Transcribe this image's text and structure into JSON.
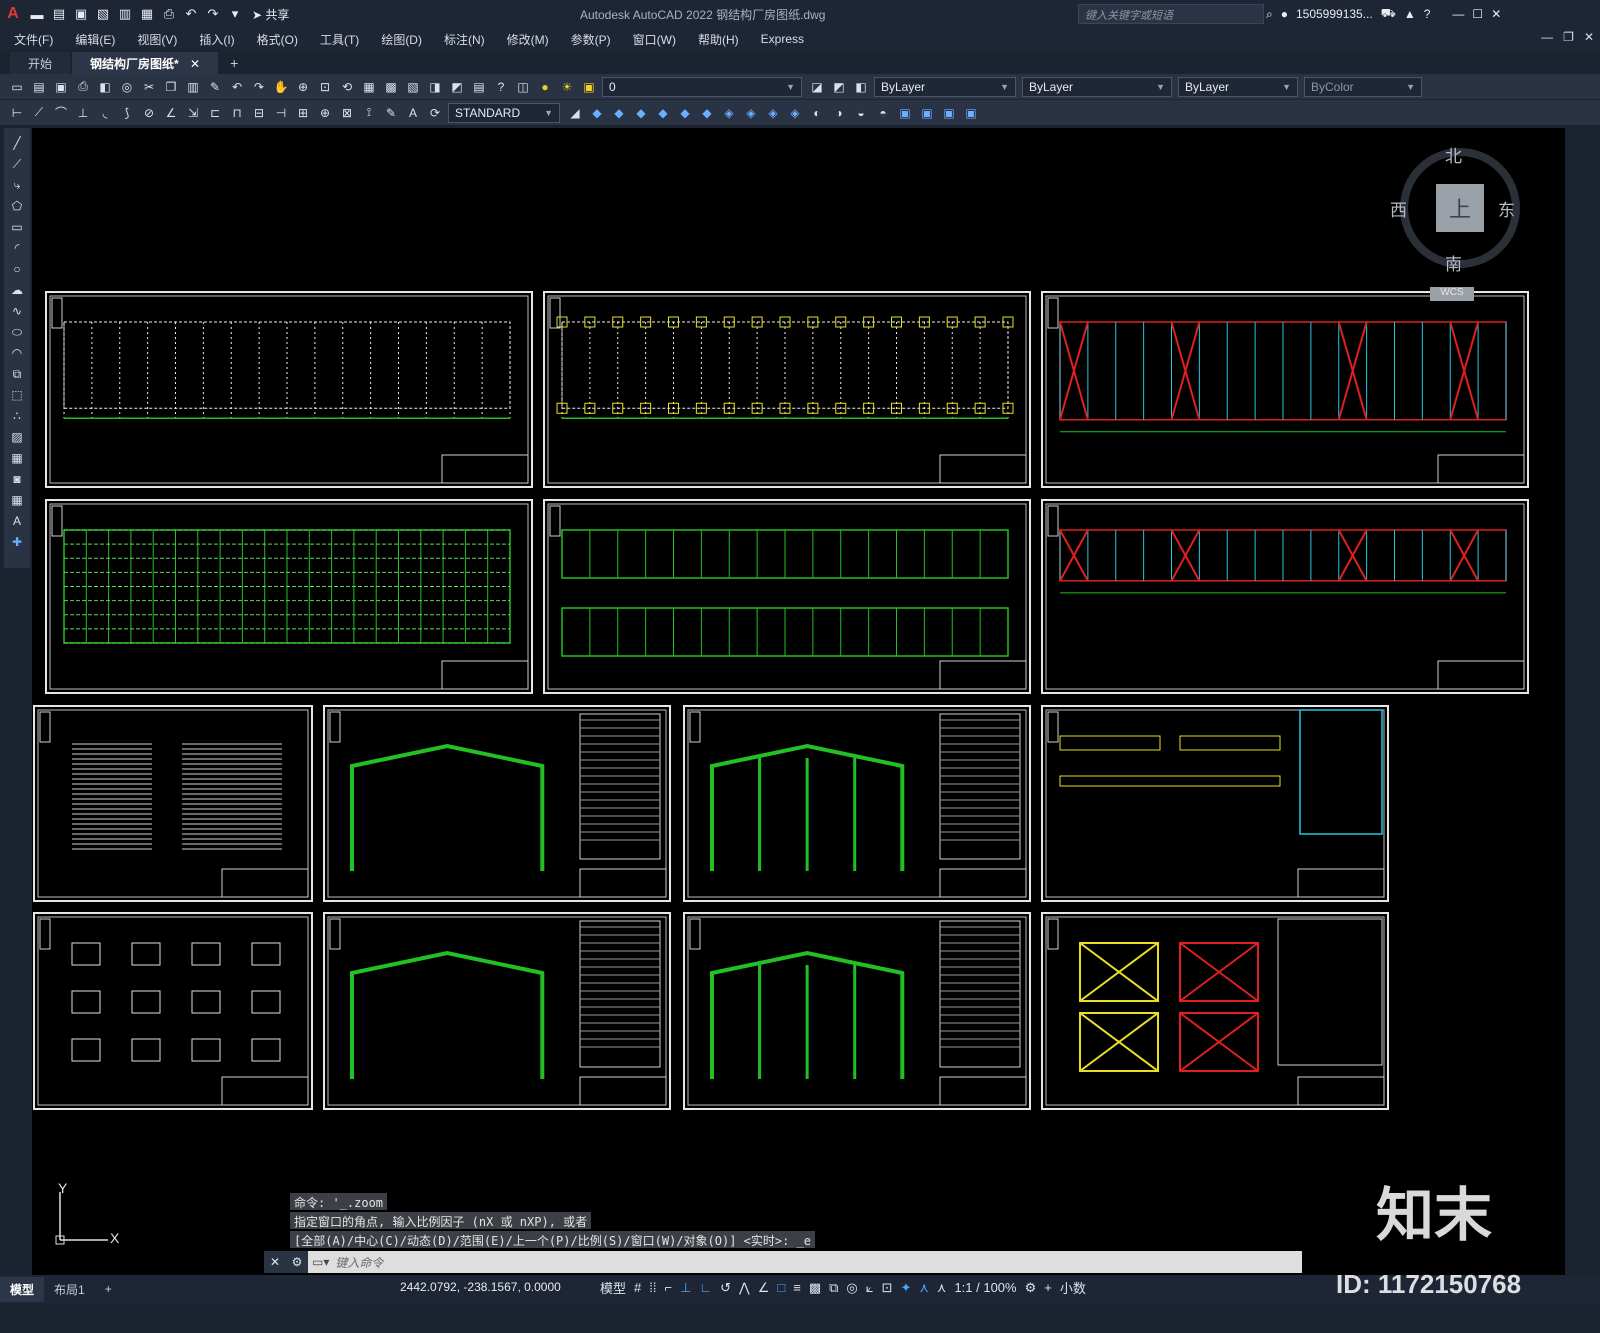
{
  "titlebar": {
    "logo": "A",
    "share_label": "共享",
    "app_title": "Autodesk AutoCAD 2022    钢结构厂房图纸.dwg",
    "search_placeholder": "键入关键字或短语",
    "user": "1505999135...",
    "quick_access_icons": [
      "new-icon",
      "open-icon",
      "save-icon",
      "save-as-icon",
      "publish-icon",
      "plot-icon",
      "undo-icon",
      "redo-icon"
    ]
  },
  "menubar": {
    "items": [
      "文件(F)",
      "编辑(E)",
      "视图(V)",
      "插入(I)",
      "格式(O)",
      "工具(T)",
      "绘图(D)",
      "标注(N)",
      "修改(M)",
      "参数(P)",
      "窗口(W)",
      "帮助(H)",
      "Express"
    ]
  },
  "tabs": {
    "items": [
      "开始",
      "钢结构厂房图纸*"
    ],
    "active": 1
  },
  "toolbar1": {
    "layer_value": "0",
    "color_value": "ByLayer",
    "linetype_value": "ByLayer",
    "lineweight_value": "ByLayer",
    "plotstyle_value": "ByColor"
  },
  "toolbar2": {
    "dimstyle_value": "STANDARD"
  },
  "viewcube": {
    "north": "北",
    "south": "南",
    "east": "东",
    "west": "西",
    "face": "上",
    "wcs": "WCS"
  },
  "ucs": {
    "y_label": "Y",
    "x_label": "X"
  },
  "command": {
    "history": [
      "命令: '_.zoom",
      "指定窗口的角点, 输入比例因子 (nX 或 nXP), 或者",
      "[全部(A)/中心(C)/动态(D)/范围(E)/上一个(P)/比例(S)/窗口(W)/对象(O)] <实时>: _e"
    ],
    "placeholder": "键入命令"
  },
  "statusbar": {
    "tabs": [
      "模型",
      "布局1"
    ],
    "active": 0,
    "coordinates": "2442.0792, -238.1567, 0.0000",
    "mode": "模型",
    "scale": "1:1 / 100%",
    "units": "小数"
  },
  "watermark": {
    "brand": "知末",
    "id_text": "ID: 1172150768"
  },
  "colors": {
    "canvas": "#000000",
    "chrome": "#1e2636",
    "toolbar": "#2a3344",
    "cad_green": "#22c022",
    "cad_red": "#e02020",
    "cad_yellow": "#e8e020",
    "cad_cyan": "#20c8e0"
  }
}
